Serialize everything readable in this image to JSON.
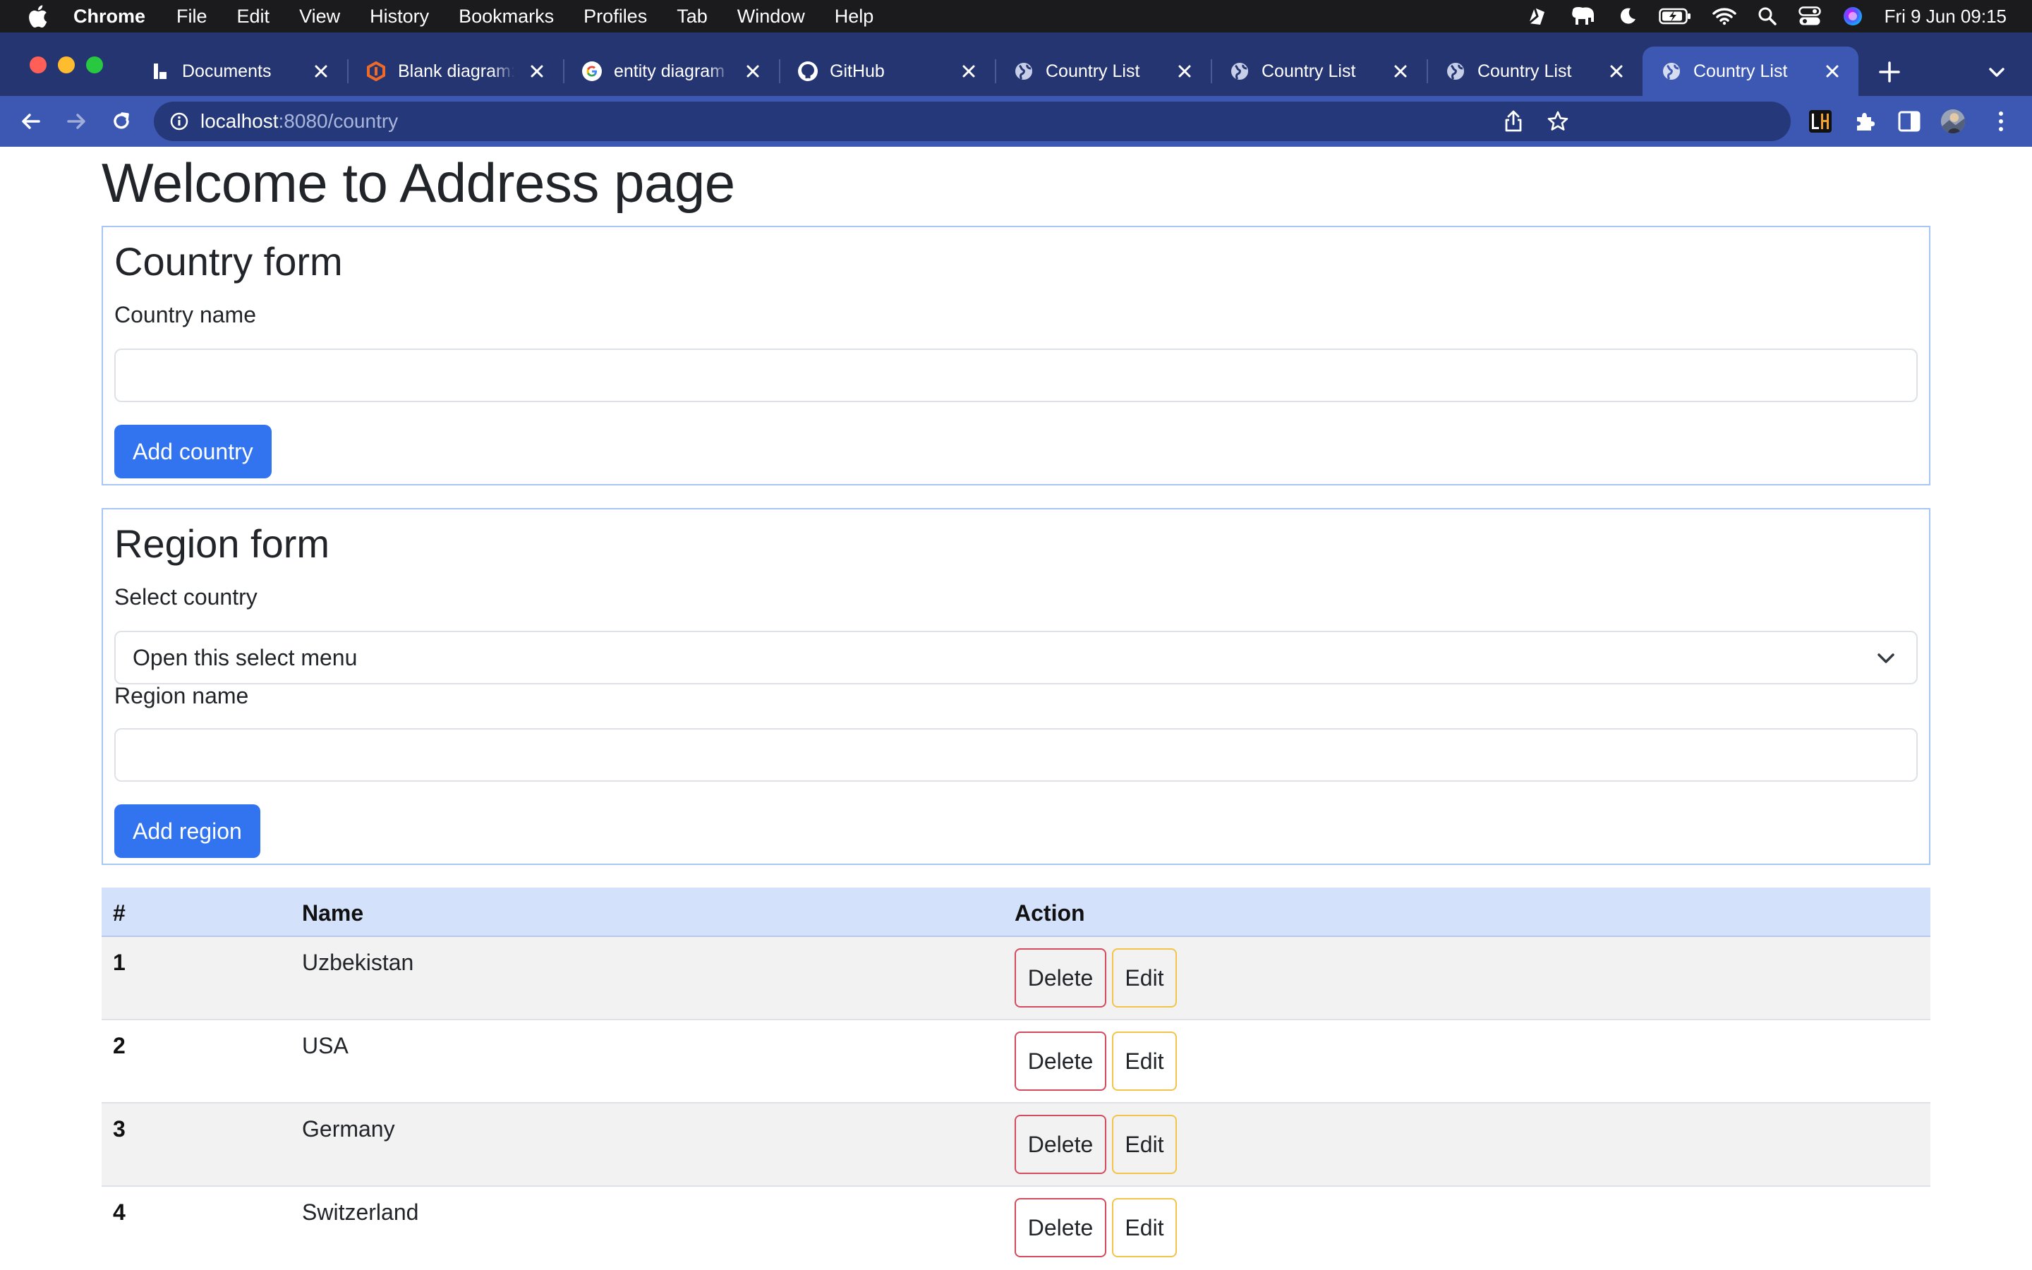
{
  "menubar": {
    "app": "Chrome",
    "items": [
      "File",
      "Edit",
      "View",
      "History",
      "Bookmarks",
      "Profiles",
      "Tab",
      "Window",
      "Help"
    ],
    "clock": "Fri 9 Jun  09:15"
  },
  "tabs": [
    {
      "title": "Documents",
      "icon": "documents-favicon"
    },
    {
      "title": "Blank diagram: Lucidchart",
      "icon": "lucidchart-favicon"
    },
    {
      "title": "entity diagram online - Google Search",
      "icon": "google-favicon"
    },
    {
      "title": "GitHub",
      "icon": "github-favicon"
    },
    {
      "title": "Country List",
      "icon": "globe-favicon"
    },
    {
      "title": "Country List",
      "icon": "globe-favicon"
    },
    {
      "title": "Country List",
      "icon": "globe-favicon"
    },
    {
      "title": "Country List",
      "icon": "globe-favicon",
      "active": true
    }
  ],
  "address": {
    "host": "localhost",
    "rest": ":8080/country"
  },
  "page": {
    "title": "Welcome to Address page",
    "country_form": {
      "heading": "Country form",
      "name_label": "Country name",
      "name_value": "",
      "submit": "Add country"
    },
    "region_form": {
      "heading": "Region form",
      "select_label": "Select country",
      "select_value": "Open this select menu",
      "name_label": "Region name",
      "name_value": "",
      "submit": "Add region"
    },
    "table": {
      "headers": [
        "#",
        "Name",
        "Action"
      ],
      "rows": [
        {
          "num": "1",
          "name": "Uzbekistan"
        },
        {
          "num": "2",
          "name": "USA"
        },
        {
          "num": "3",
          "name": "Germany"
        },
        {
          "num": "4",
          "name": "Switzerland"
        }
      ],
      "delete_label": "Delete",
      "edit_label": "Edit"
    }
  },
  "colors": {
    "tabstrip": "#253571",
    "toolbar": "#3c58b3",
    "primary_button": "#3274f0",
    "table_header": "#d3e1fb",
    "delete_border": "#d34b5c",
    "edit_border": "#f3c44a"
  }
}
